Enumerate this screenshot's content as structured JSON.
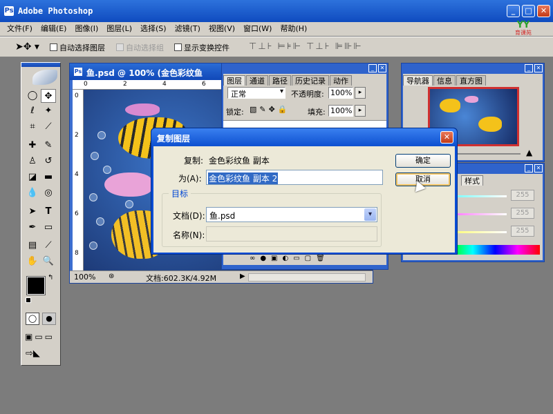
{
  "app": {
    "title": "Adobe Photoshop",
    "brand_mark": "YY",
    "brand_sub": "育课苑"
  },
  "menu": [
    "文件(F)",
    "编辑(E)",
    "图像(I)",
    "图层(L)",
    "选择(S)",
    "滤镜(T)",
    "视图(V)",
    "窗口(W)",
    "帮助(H)"
  ],
  "options_bar": {
    "auto_select_layer": "自动选择图层",
    "auto_select_group": "自动选择组",
    "show_transform": "显示变换控件"
  },
  "document": {
    "title": "鱼.psd @ 100% (金色彩纹鱼",
    "zoom": "100%",
    "doc_size": "文档:602.3K/4.92M",
    "ruler_h": [
      "0",
      "2",
      "4",
      "6"
    ],
    "ruler_v": [
      "0",
      "2",
      "4",
      "6",
      "8"
    ]
  },
  "layers_panel": {
    "tabs": [
      "图层",
      "通道",
      "路径",
      "历史记录",
      "动作"
    ],
    "blend_mode": "正常",
    "opacity_label": "不透明度:",
    "opacity": "100%",
    "lock_label": "锁定:",
    "fill_label": "填充:",
    "fill": "100%"
  },
  "navigator_panel": {
    "tabs": [
      "导航器",
      "信息",
      "直方图"
    ]
  },
  "color_panel": {
    "tab": "样式",
    "values": [
      "255",
      "255",
      "255"
    ]
  },
  "dialog": {
    "title": "复制图层",
    "copy_label": "复制:",
    "copy_value": "金色彩纹鱼 副本",
    "as_label": "为(A):",
    "as_value": "金色彩纹鱼 副本 2",
    "ok": "确定",
    "cancel": "取消",
    "group_label": "目标",
    "doc_label": "文档(D):",
    "doc_value": "鱼.psd",
    "name_label": "名称(N):",
    "name_value": ""
  }
}
